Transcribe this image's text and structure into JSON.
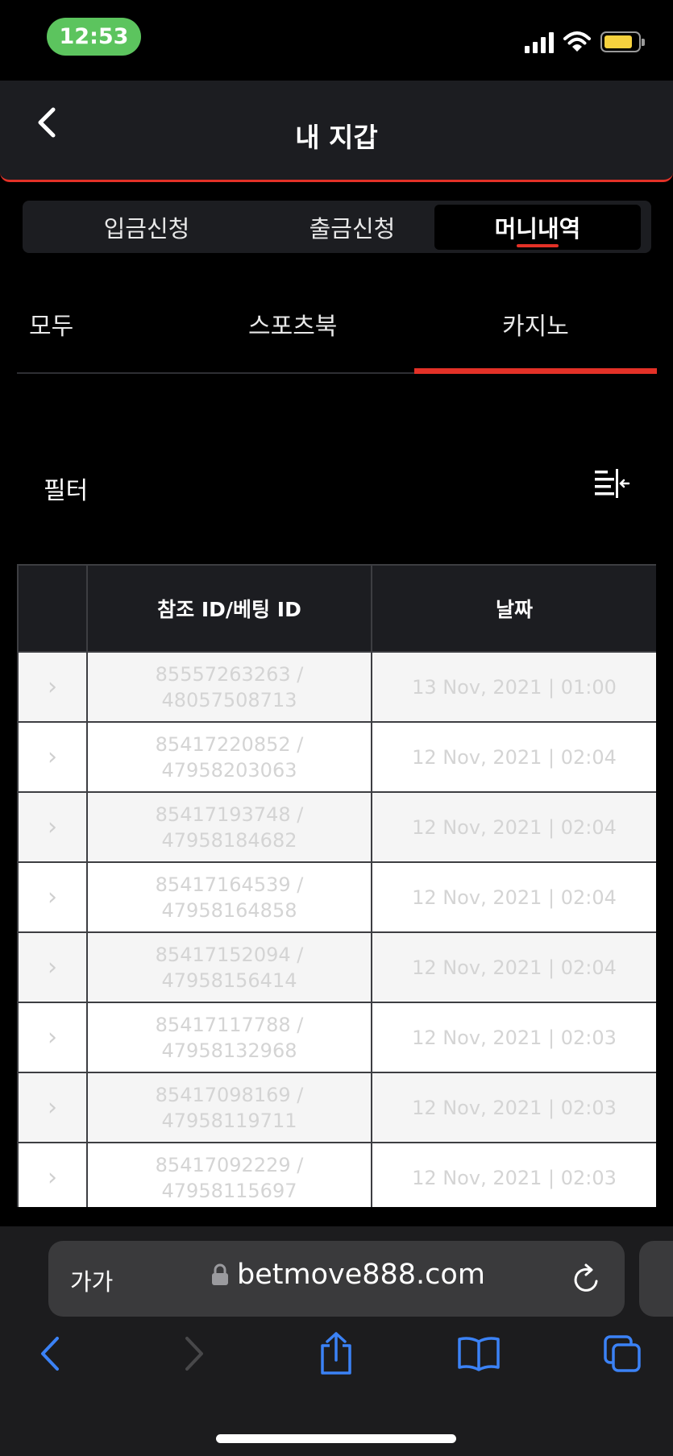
{
  "status_bar": {
    "time": "12:53"
  },
  "header": {
    "title": "내 지갑"
  },
  "segments": [
    {
      "label": "입금신청",
      "active": false
    },
    {
      "label": "출금신청",
      "active": false
    },
    {
      "label": "머니내역",
      "active": true
    }
  ],
  "category_tabs": [
    {
      "label": "모두",
      "active": false
    },
    {
      "label": "스포츠북",
      "active": false
    },
    {
      "label": "카지노",
      "active": true
    }
  ],
  "filter": {
    "label": "필터"
  },
  "table": {
    "columns": [
      "참조 ID/베팅 ID",
      "날짜"
    ],
    "rows": [
      {
        "ref_id": "85557263263 /",
        "bet_id": "48057508713",
        "date": "13 Nov, 2021 | 01:00"
      },
      {
        "ref_id": "85417220852 /",
        "bet_id": "47958203063",
        "date": "12 Nov, 2021 | 02:04"
      },
      {
        "ref_id": "85417193748 /",
        "bet_id": "47958184682",
        "date": "12 Nov, 2021 | 02:04"
      },
      {
        "ref_id": "85417164539 /",
        "bet_id": "47958164858",
        "date": "12 Nov, 2021 | 02:04"
      },
      {
        "ref_id": "85417152094 /",
        "bet_id": "47958156414",
        "date": "12 Nov, 2021 | 02:04"
      },
      {
        "ref_id": "85417117788 /",
        "bet_id": "47958132968",
        "date": "12 Nov, 2021 | 02:03"
      },
      {
        "ref_id": "85417098169 /",
        "bet_id": "47958119711",
        "date": "12 Nov, 2021 | 02:03"
      },
      {
        "ref_id": "85417092229 /",
        "bet_id": "47958115697",
        "date": "12 Nov, 2021 | 02:03"
      }
    ]
  },
  "browser": {
    "aa_label": "가가",
    "url": "betmove888.com"
  },
  "colors": {
    "accent": "#e33127",
    "header_bg": "#1c1d21",
    "time_pill": "#5cc45e",
    "ios_blue": "#3b82f6"
  }
}
